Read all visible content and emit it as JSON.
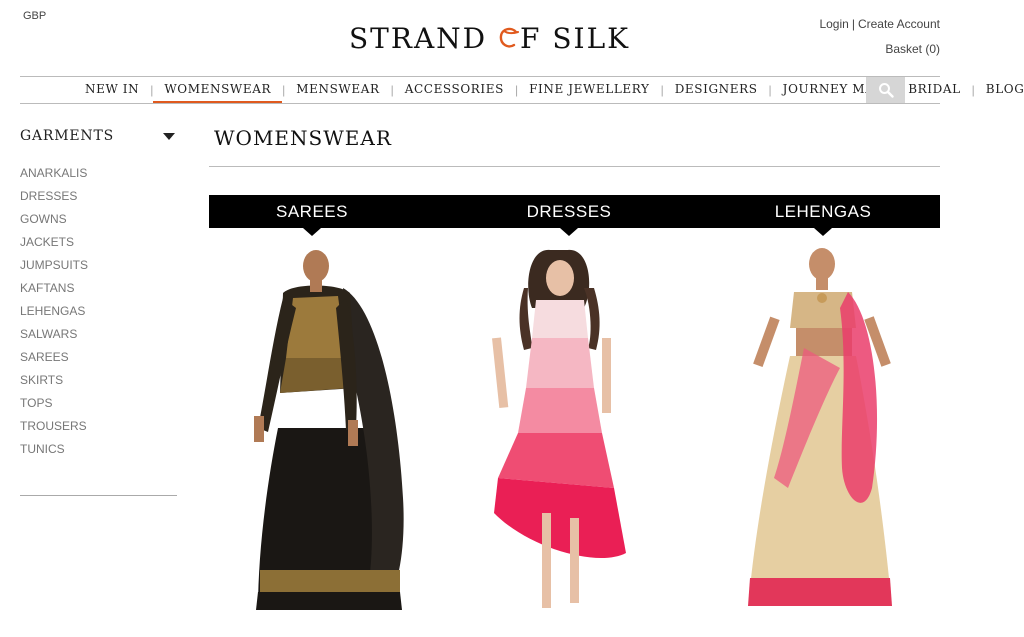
{
  "header": {
    "currency": "GBP",
    "login": "Login",
    "separator": "|",
    "create_account": "Create Account",
    "basket": "Basket (0)"
  },
  "logo": {
    "part1": "STRAND ",
    "part2": "F SILK",
    "accent_color": "#e05a1e"
  },
  "nav": {
    "items": [
      "NEW IN",
      "WOMENSWEAR",
      "MENSWEAR",
      "ACCESSORIES",
      "FINE JEWELLERY",
      "DESIGNERS",
      "JOURNEY MAP",
      "BRIDAL",
      "BLOG"
    ],
    "active_item": "WOMENSWEAR",
    "search_icon": "search-icon"
  },
  "sidebar": {
    "title": "GARMENTS",
    "items": [
      "ANARKALIS",
      "DRESSES",
      "GOWNS",
      "JACKETS",
      "JUMPSUITS",
      "KAFTANS",
      "LEHENGAS",
      "SALWARS",
      "SAREES",
      "SKIRTS",
      "TOPS",
      "TROUSERS",
      "TUNICS"
    ]
  },
  "main": {
    "title": "WOMENSWEAR",
    "categories": [
      "SAREES",
      "DRESSES",
      "LEHENGAS"
    ]
  },
  "colors": {
    "accent": "#e05a1e",
    "category_bar": "#000000",
    "search_bg": "#d6d6d6"
  }
}
